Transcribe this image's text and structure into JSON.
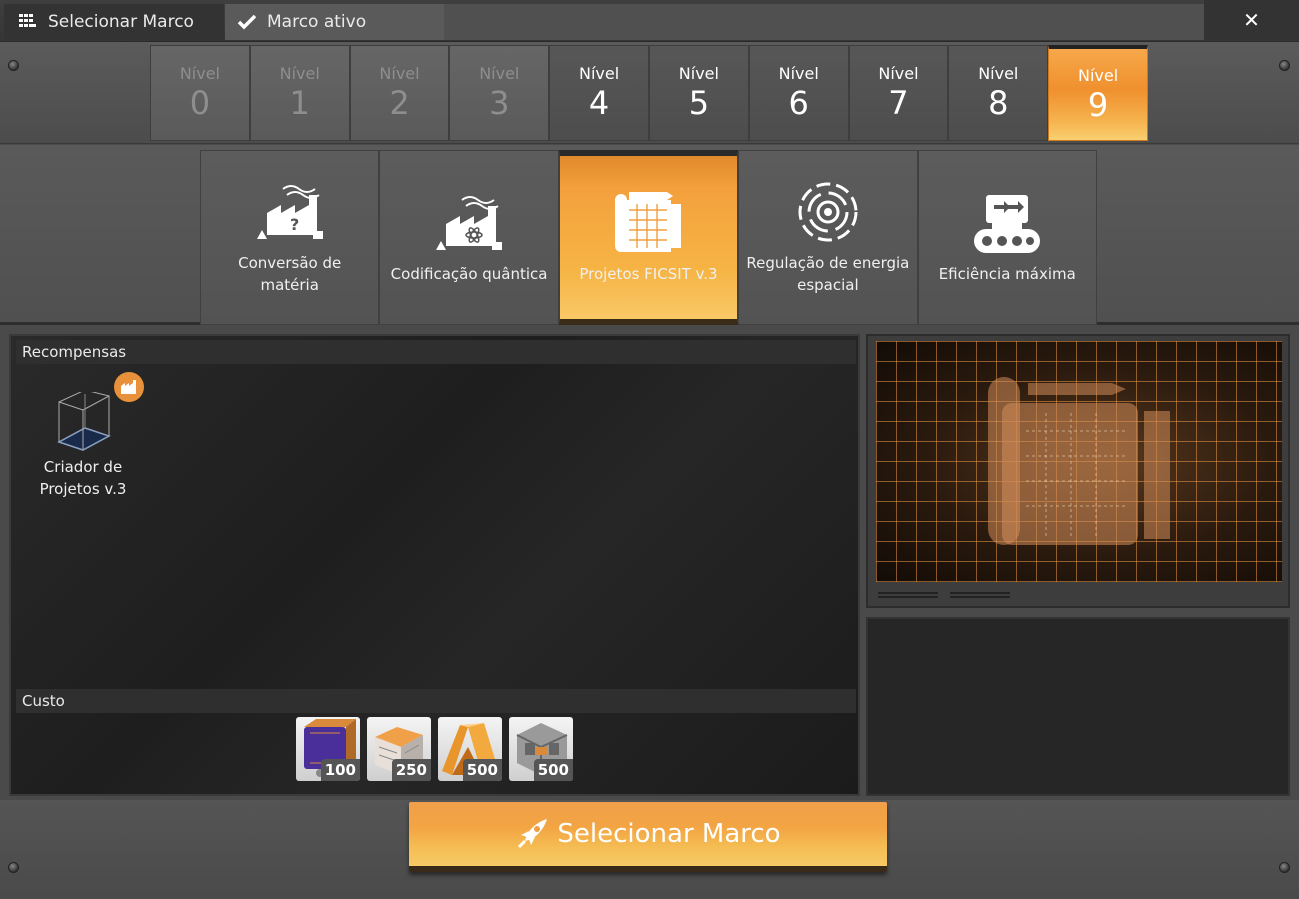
{
  "tabs": [
    {
      "label": "Selecionar Marco",
      "icon": "grid-icon"
    },
    {
      "label": "Marco ativo",
      "icon": "checkmark-icon"
    }
  ],
  "close_label": "✕",
  "tiers": [
    {
      "label": "Nível",
      "number": "0",
      "state": "locked"
    },
    {
      "label": "Nível",
      "number": "1",
      "state": "locked"
    },
    {
      "label": "Nível",
      "number": "2",
      "state": "locked"
    },
    {
      "label": "Nível",
      "number": "3",
      "state": "locked"
    },
    {
      "label": "Nível",
      "number": "4",
      "state": "open"
    },
    {
      "label": "Nível",
      "number": "5",
      "state": "open"
    },
    {
      "label": "Nível",
      "number": "6",
      "state": "open"
    },
    {
      "label": "Nível",
      "number": "7",
      "state": "open"
    },
    {
      "label": "Nível",
      "number": "8",
      "state": "open"
    },
    {
      "label": "Nível",
      "number": "9",
      "state": "active"
    }
  ],
  "milestones": [
    {
      "label": "Conversão de matéria",
      "icon": "factory-question-icon"
    },
    {
      "label": "Codificação quântica",
      "icon": "factory-atom-icon"
    },
    {
      "label": "Projetos FICSIT v.3",
      "icon": "blueprint-icon",
      "active": true
    },
    {
      "label": "Regulação de energia espacial",
      "icon": "spatial-energy-icon"
    },
    {
      "label": "Eficiência máxima",
      "icon": "conveyor-icon"
    }
  ],
  "rewards": {
    "heading": "Recompensas",
    "items": [
      {
        "name": "Criador de Projetos v.3",
        "icon": "blueprint-designer-icon",
        "badge_icon": "factory-badge-icon"
      }
    ]
  },
  "cost": {
    "heading": "Custo",
    "items": [
      {
        "icon": "purple-cube-icon",
        "quantity": "100"
      },
      {
        "icon": "orange-block-icon",
        "quantity": "250"
      },
      {
        "icon": "orange-frame-icon",
        "quantity": "500"
      },
      {
        "icon": "grey-frame-icon",
        "quantity": "500"
      }
    ]
  },
  "select_button": {
    "label": "Selecionar Marco",
    "icon": "rocket-icon"
  },
  "colors": {
    "accent": "#f0a040",
    "panel": "#1e1e1e"
  }
}
